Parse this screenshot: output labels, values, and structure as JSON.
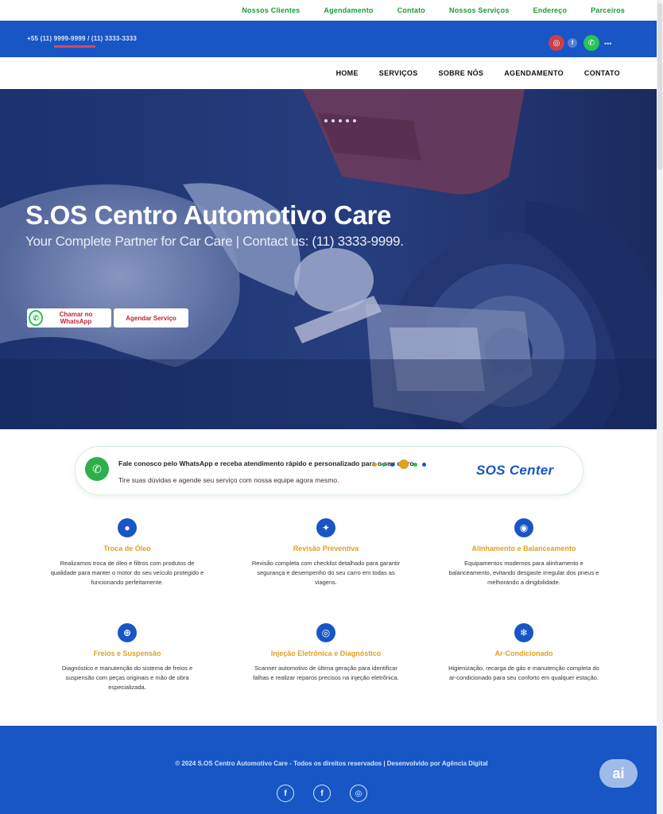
{
  "top_links": [
    "Nossos Clientes",
    "Agendamento",
    "Contato",
    "Nossos Serviços",
    "Endereço",
    "Parceiros"
  ],
  "contact_bar": {
    "phone": "+55 (11) 9999-9999 / (11) 3333-3333",
    "icons": [
      "instagram-icon",
      "facebook-icon",
      "whatsapp-icon"
    ]
  },
  "nav": [
    "HOME",
    "SERVIÇOS",
    "SOBRE NÓS",
    "AGENDAMENTO",
    "CONTATO"
  ],
  "hero": {
    "title": "S.OS Centro Automotivo Care",
    "tagline": "Your Complete Partner for Car Care | Contact us: (11) 3333-9999."
  },
  "buttons": {
    "whatsapp": "Chamar no WhatsApp",
    "schedule": "Agendar Serviço"
  },
  "promo": {
    "line1": "Fale conosco pelo WhatsApp e receba atendimento rápido e personalizado para o seu carro",
    "line2": "Tire suas dúvidas e agende seu serviço com nossa equipe agora mesmo.",
    "brand": "SOS Center"
  },
  "services": [
    {
      "title": "Troca de Óleo",
      "desc": "Realizamos troca de óleo e filtros com produtos de qualidade para manter o motor do seu veículo protegido e funcionando perfeitamente.",
      "icon": "oil-icon"
    },
    {
      "title": "Revisão Preventiva",
      "desc": "Revisão completa com checklist detalhado para garantir segurança e desempenho do seu carro em todas as viagens.",
      "icon": "wrench-icon"
    },
    {
      "title": "Alinhamento e Balanceamento",
      "desc": "Equipamentos modernos para alinhamento e balanceamento, evitando desgaste irregular dos pneus e melhorando a dirigibilidade.",
      "icon": "tire-icon"
    },
    {
      "title": "Freios e Suspensão",
      "desc": "Diagnóstico e manutenção do sistema de freios e suspensão com peças originais e mão de obra especializada.",
      "icon": "brake-icon"
    },
    {
      "title": "Injeção Eletrônica e Diagnóstico",
      "desc": "Scanner automotivo de última geração para identificar falhas e realizar reparos precisos na injeção eletrônica.",
      "icon": "scanner-icon"
    },
    {
      "title": "Ar-Condicionado",
      "desc": "Higienização, recarga de gás e manutenção completa do ar-condicionado para seu conforto em qualquer estação.",
      "icon": "ac-icon"
    }
  ],
  "footer": {
    "copyright": "© 2024 S.OS Centro Automotivo Care - Todos os direitos reservados | Desenvolvido por Agência Digital",
    "socials": [
      "facebook-icon",
      "facebook-icon",
      "instagram-icon"
    ],
    "badge": "ai"
  },
  "colors": {
    "brand_blue": "#1756c4",
    "accent_green": "#2bc05a",
    "accent_red": "#c0273a",
    "accent_gold": "#e0a020"
  }
}
